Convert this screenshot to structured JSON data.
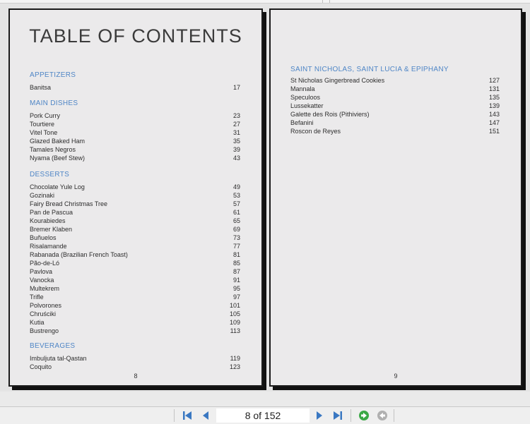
{
  "viewer": {
    "page_indicator": "8 of 152"
  },
  "left_page": {
    "title": "TABLE OF CONTENTS",
    "page_number": "8",
    "sections": [
      {
        "heading": "APPETIZERS",
        "entries": [
          {
            "name": "Banitsa",
            "page": "17"
          }
        ]
      },
      {
        "heading": "MAIN DISHES",
        "entries": [
          {
            "name": "Pork Curry",
            "page": "23"
          },
          {
            "name": "Tourtiere",
            "page": "27"
          },
          {
            "name": "Vitel Tone",
            "page": "31"
          },
          {
            "name": "Glazed Baked Ham",
            "page": "35"
          },
          {
            "name": "Tamales Negros",
            "page": "39"
          },
          {
            "name": "Nyama (Beef Stew)",
            "page": "43"
          }
        ]
      },
      {
        "heading": "DESSERTS",
        "entries": [
          {
            "name": "Chocolate Yule Log",
            "page": "49"
          },
          {
            "name": "Gozinaki",
            "page": "53"
          },
          {
            "name": "Fairy Bread Christmas Tree",
            "page": "57"
          },
          {
            "name": "Pan de Pascua",
            "page": "61"
          },
          {
            "name": "Kourabiedes",
            "page": "65"
          },
          {
            "name": "Bremer Klaben",
            "page": "69"
          },
          {
            "name": "Buñuelos",
            "page": "73"
          },
          {
            "name": "Risalamande",
            "page": "77"
          },
          {
            "name": "Rabanada (Brazilian French Toast)",
            "page": "81"
          },
          {
            "name": "Pão-de-Ló",
            "page": "85"
          },
          {
            "name": "Pavlova",
            "page": "87"
          },
          {
            "name": "Vanocka",
            "page": "91"
          },
          {
            "name": "Multekrem",
            "page": "95"
          },
          {
            "name": "Trifle",
            "page": "97"
          },
          {
            "name": "Polvorones",
            "page": "101"
          },
          {
            "name": "Chruściki",
            "page": "105"
          },
          {
            "name": "Kutia",
            "page": "109"
          },
          {
            "name": "Bustrengo",
            "page": "113"
          }
        ]
      },
      {
        "heading": "BEVERAGES",
        "entries": [
          {
            "name": "Imbuljuta tal-Qastan",
            "page": "119"
          },
          {
            "name": "Coquito",
            "page": "123"
          }
        ]
      }
    ]
  },
  "right_page": {
    "page_number": "9",
    "sections": [
      {
        "heading": "SAINT NICHOLAS, SAINT LUCIA & EPIPHANY",
        "entries": [
          {
            "name": "St Nicholas Gingerbread Cookies",
            "page": "127"
          },
          {
            "name": "Mannala",
            "page": "131"
          },
          {
            "name": "Speculoos",
            "page": "135"
          },
          {
            "name": "Lussekatter",
            "page": "139"
          },
          {
            "name": "Galette des Rois (Pithiviers)",
            "page": "143"
          },
          {
            "name": "Befanini",
            "page": "147"
          },
          {
            "name": "Roscon de Reyes",
            "page": "151"
          }
        ]
      }
    ]
  },
  "icons": {
    "first": "first-page-icon",
    "prev": "previous-page-icon",
    "next": "next-page-icon",
    "last": "last-page-icon",
    "go": "go-forward-icon",
    "back": "go-back-icon"
  },
  "colors": {
    "section_heading": "#4f86c6",
    "nav_arrow": "#3a78c2",
    "go_green": "#3aa845",
    "disabled_gray": "#b0b0b0"
  }
}
